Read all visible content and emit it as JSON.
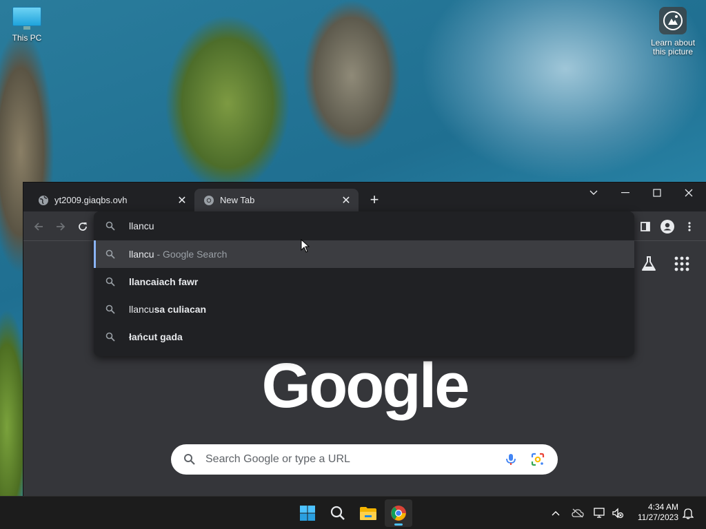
{
  "desktop": {
    "icons": [
      {
        "label": "This PC"
      },
      {
        "label": "Learn about this picture"
      }
    ]
  },
  "browser": {
    "tabs": [
      {
        "title": "yt2009.giaqbs.ovh",
        "active": false
      },
      {
        "title": "New Tab",
        "active": true
      }
    ],
    "omnibox": {
      "value": "llancu",
      "suggestions": [
        {
          "prefix": "llancu",
          "bold": "",
          "suffix": " - Google Search",
          "selected": true
        },
        {
          "prefix": "",
          "bold": "llancaiach fawr",
          "suffix": "",
          "selected": false
        },
        {
          "prefix": "llancu",
          "bold": "sa culiacan",
          "suffix": "",
          "selected": false
        },
        {
          "prefix": "",
          "bold": "łańcut gada",
          "suffix": "",
          "selected": false
        }
      ]
    },
    "ntp": {
      "logo": "Google",
      "search_placeholder": "Search Google or type a URL"
    }
  },
  "taskbar": {
    "clock_time": "4:34 AM",
    "clock_date": "11/27/2023"
  },
  "colors": {
    "accent": "#8ab4f8",
    "browser_bg": "#35363a",
    "tabstrip_bg": "#202124",
    "taskbar_bg": "#1c1c1c"
  }
}
